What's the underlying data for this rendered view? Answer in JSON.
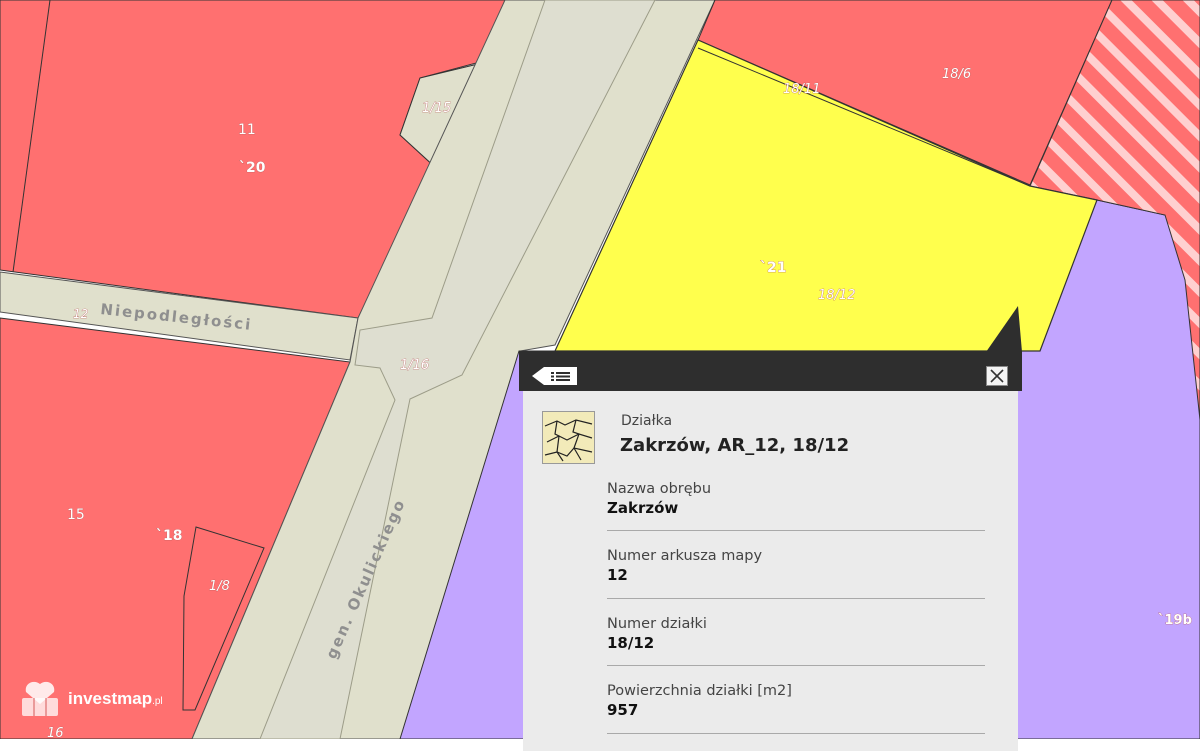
{
  "map": {
    "streets": [
      {
        "id": "niepodleglosci",
        "name": "Niepodległości"
      },
      {
        "id": "okulickiego",
        "name": "gen. Okulickiego"
      }
    ],
    "parcel_labels": [
      {
        "id": "p11",
        "text": "11"
      },
      {
        "id": "p20",
        "text": "`20"
      },
      {
        "id": "p1_15",
        "text": "1/15"
      },
      {
        "id": "p12",
        "text": "12"
      },
      {
        "id": "p1_16",
        "text": "1/16"
      },
      {
        "id": "p15",
        "text": "15"
      },
      {
        "id": "p18",
        "text": "`18"
      },
      {
        "id": "p1_8",
        "text": "1/8"
      },
      {
        "id": "p16",
        "text": "16"
      },
      {
        "id": "p18_11",
        "text": "18/11"
      },
      {
        "id": "p18_6",
        "text": "18/6"
      },
      {
        "id": "p21",
        "text": "`21"
      },
      {
        "id": "p18_12",
        "text": "18/12"
      },
      {
        "id": "p19b",
        "text": "`19b"
      }
    ],
    "colors": {
      "residential": "#ff7070",
      "road": "#e0e0cc",
      "selected_parcel": "#ffff4d",
      "service": "#c2a5ff",
      "hatch": "#ffd0d0"
    }
  },
  "popup": {
    "list_button_icon": "list-icon",
    "close_icon": "close-icon",
    "layer_thumbnail_icon": "parcel-map-icon",
    "feature_type": "Działka",
    "feature_title": "Zakrzów, AR_12, 18/12",
    "fields": [
      {
        "label": "Nazwa obrębu",
        "value": "Zakrzów"
      },
      {
        "label": "Numer arkusza mapy",
        "value": "12"
      },
      {
        "label": "Numer działki",
        "value": "18/12"
      },
      {
        "label": "Powierzchnia działki [m2]",
        "value": "957"
      }
    ]
  },
  "watermark": {
    "brand": "investmap",
    "suffix": ".pl",
    "logo_icon": "investmap-logo-icon"
  }
}
